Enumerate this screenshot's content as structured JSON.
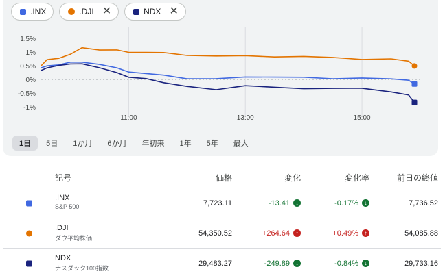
{
  "chips": [
    {
      "label": ".INX",
      "color": "#4169e1",
      "shape": "square",
      "closable": false
    },
    {
      "label": ".DJI",
      "color": "#e37400",
      "shape": "circle",
      "closable": true
    },
    {
      "label": "NDX",
      "color": "#1a237e",
      "shape": "square",
      "closable": true
    }
  ],
  "close_glyph": "✕",
  "chart_data": {
    "type": "line",
    "y_ticks": [
      "1.5%",
      "1%",
      "0.5%",
      "0%",
      "-0.5%",
      "-1%"
    ],
    "x_ticks": [
      "11:00",
      "13:00",
      "15:00"
    ],
    "ylim": [
      -1.1,
      1.6
    ],
    "xlim": [
      9.5,
      16.0
    ],
    "series": [
      {
        "name": ".DJI",
        "color": "#e37400",
        "x": [
          9.5,
          9.6,
          9.8,
          10.0,
          10.2,
          10.5,
          10.8,
          11.0,
          11.3,
          11.6,
          12.0,
          12.5,
          13.0,
          13.5,
          14.0,
          14.5,
          15.0,
          15.5,
          15.8,
          15.9
        ],
        "y": [
          0.5,
          0.7,
          0.8,
          0.9,
          1.15,
          1.1,
          1.05,
          1.0,
          1.0,
          0.95,
          0.9,
          0.85,
          0.85,
          0.85,
          0.82,
          0.8,
          0.75,
          0.72,
          0.68,
          0.49
        ]
      },
      {
        "name": ".INX",
        "color": "#4169e1",
        "x": [
          9.5,
          9.6,
          9.8,
          10.0,
          10.2,
          10.5,
          10.8,
          11.0,
          11.3,
          11.6,
          12.0,
          12.5,
          13.0,
          13.5,
          14.0,
          14.5,
          15.0,
          15.5,
          15.8,
          15.9
        ],
        "y": [
          0.4,
          0.5,
          0.55,
          0.6,
          0.65,
          0.55,
          0.4,
          0.3,
          0.2,
          0.15,
          0.05,
          0.0,
          0.1,
          0.1,
          0.05,
          0.05,
          0.05,
          0.0,
          0.0,
          -0.17
        ]
      },
      {
        "name": "NDX",
        "color": "#1a237e",
        "x": [
          9.5,
          9.6,
          9.8,
          10.0,
          10.2,
          10.5,
          10.8,
          11.0,
          11.3,
          11.6,
          12.0,
          12.5,
          13.0,
          13.5,
          14.0,
          14.5,
          15.0,
          15.5,
          15.8,
          15.9
        ],
        "y": [
          0.3,
          0.45,
          0.5,
          0.55,
          0.6,
          0.4,
          0.25,
          0.1,
          0.0,
          -0.1,
          -0.25,
          -0.4,
          -0.2,
          -0.3,
          -0.35,
          -0.3,
          -0.35,
          -0.45,
          -0.55,
          -0.84
        ]
      }
    ]
  },
  "ranges": [
    "1日",
    "5日",
    "1か月",
    "6か月",
    "年初来",
    "1年",
    "5年",
    "最大"
  ],
  "active_range": 0,
  "table": {
    "headers": {
      "symbol": "記号",
      "price": "価格",
      "change": "変化",
      "change_pct": "変化率",
      "prev_close": "前日の終値"
    },
    "rows": [
      {
        "symbol": ".INX",
        "desc": "S&P 500",
        "price": "7,723.11",
        "change": "-13.41",
        "change_pct": "-0.17%",
        "prev_close": "7,736.52",
        "direction": "down",
        "color": "#4169e1",
        "shape": "square"
      },
      {
        "symbol": ".DJI",
        "desc": "ダウ平均株価",
        "price": "54,350.52",
        "change": "+264.64",
        "change_pct": "+0.49%",
        "prev_close": "54,085.88",
        "direction": "up",
        "color": "#e37400",
        "shape": "circle"
      },
      {
        "symbol": "NDX",
        "desc": "ナスダック100指数",
        "price": "29,483.27",
        "change": "-249.89",
        "change_pct": "-0.84%",
        "prev_close": "29,733.16",
        "direction": "down",
        "color": "#1a237e",
        "shape": "square"
      }
    ]
  }
}
